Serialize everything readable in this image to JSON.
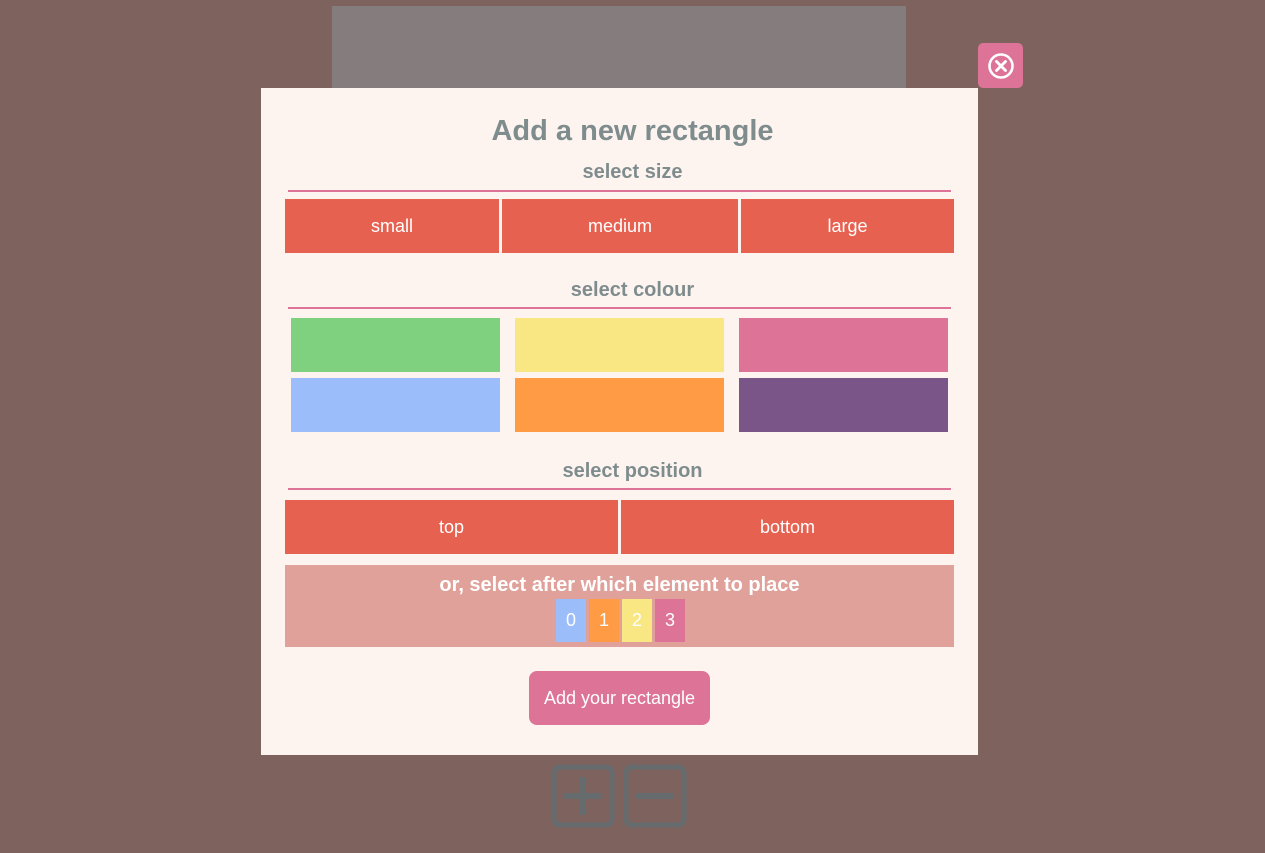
{
  "modal": {
    "title": "Add a new rectangle",
    "size_section": {
      "title": "select size",
      "options": [
        "small",
        "medium",
        "large"
      ]
    },
    "colour_section": {
      "title": "select colour",
      "swatches": [
        "#7fd180",
        "#f9e784",
        "#dd7396",
        "#9bbdfa",
        "#ff9b44",
        "#7a5588"
      ]
    },
    "position_section": {
      "title": "select position",
      "options": [
        "top",
        "bottom"
      ]
    },
    "after_section": {
      "label": "or, select after which element to place",
      "elements": [
        {
          "label": "0",
          "color": "#9bbdfa"
        },
        {
          "label": "1",
          "color": "#ff9b44"
        },
        {
          "label": "2",
          "color": "#f9e784"
        },
        {
          "label": "3",
          "color": "#dd7396"
        }
      ]
    },
    "submit_label": "Add your rectangle"
  },
  "colors": {
    "background": "#7d625e",
    "modal_bg": "#fdf4f0",
    "accent": "#dd7396",
    "option_button": "#e76150",
    "after_box": "#e0a19b",
    "heading_text": "#7f8c8d",
    "icon_gray": "#666b6e"
  },
  "icons": {
    "close": "close-circle-icon",
    "add": "plus-square-icon",
    "remove": "minus-square-icon"
  }
}
